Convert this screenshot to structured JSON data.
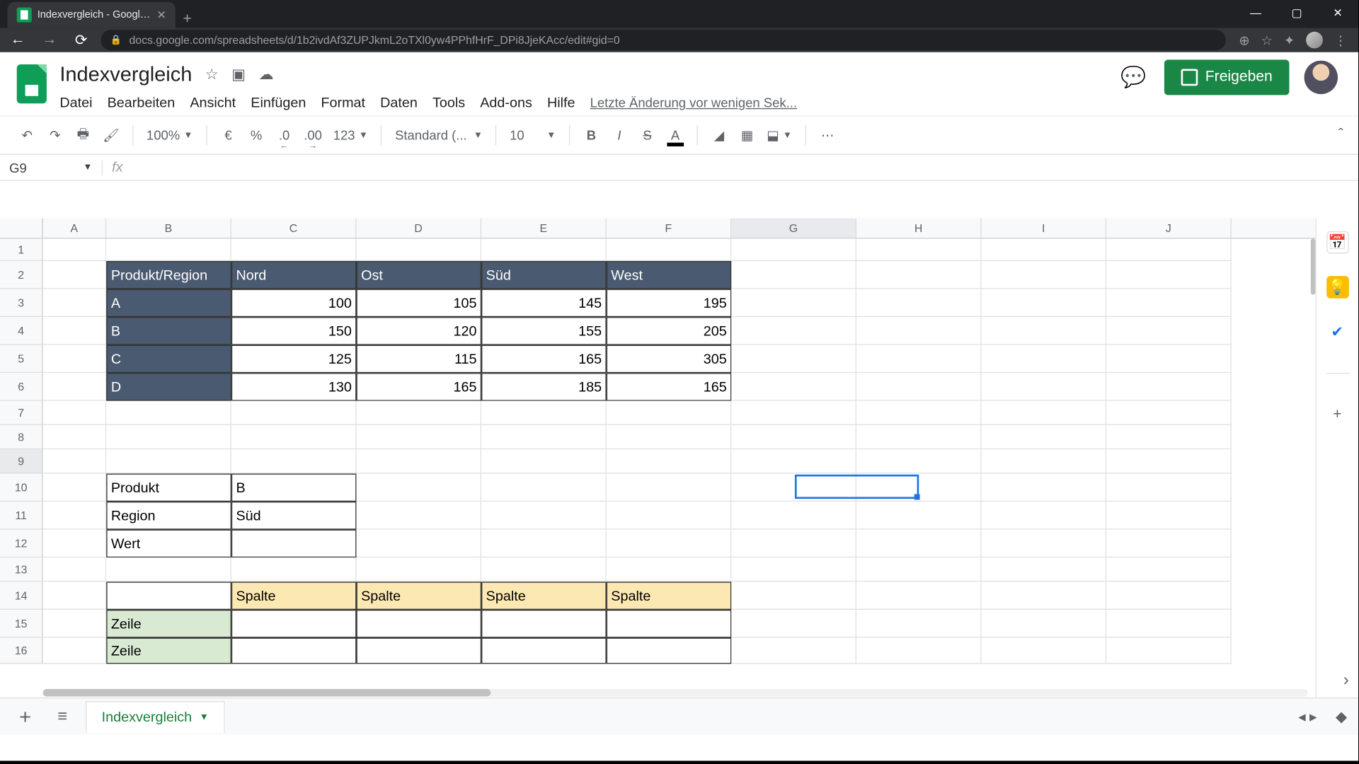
{
  "browser": {
    "tab_title": "Indexvergleich - Google Tabellen",
    "url": "docs.google.com/spreadsheets/d/1b2ivdAf3ZUPJkmL2oTXl0yw4PPhfHrF_DPi8JjeKAcc/edit#gid=0"
  },
  "doc": {
    "title": "Indexvergleich",
    "last_edit": "Letzte Änderung vor wenigen Sek..."
  },
  "menus": [
    "Datei",
    "Bearbeiten",
    "Ansicht",
    "Einfügen",
    "Format",
    "Daten",
    "Tools",
    "Add-ons",
    "Hilfe"
  ],
  "share_label": "Freigeben",
  "toolbar": {
    "zoom": "100%",
    "currency": "€",
    "percent": "%",
    "dec_less": ".0",
    "dec_more": ".00",
    "numfmt": "123",
    "font": "Standard (...",
    "fontsize": "10"
  },
  "formula": {
    "cell_ref": "G9",
    "value": ""
  },
  "columns": [
    "A",
    "B",
    "C",
    "D",
    "E",
    "F",
    "G",
    "H",
    "I",
    "J"
  ],
  "table1": {
    "header": [
      "Produkt/Region",
      "Nord",
      "Ost",
      "Süd",
      "West"
    ],
    "rows": [
      {
        "label": "A",
        "vals": [
          "100",
          "105",
          "145",
          "195"
        ]
      },
      {
        "label": "B",
        "vals": [
          "150",
          "120",
          "155",
          "205"
        ]
      },
      {
        "label": "C",
        "vals": [
          "125",
          "115",
          "165",
          "305"
        ]
      },
      {
        "label": "D",
        "vals": [
          "130",
          "165",
          "185",
          "165"
        ]
      }
    ]
  },
  "lookup": {
    "r1": [
      "Produkt",
      "B"
    ],
    "r2": [
      "Region",
      "Süd"
    ],
    "r3": [
      "Wert",
      ""
    ]
  },
  "matrix": {
    "cols": [
      "Spalte",
      "Spalte",
      "Spalte",
      "Spalte"
    ],
    "rows": [
      "Zeile",
      "Zeile"
    ]
  },
  "sheet_tab": "Indexvergleich",
  "selected_cell": "G9"
}
